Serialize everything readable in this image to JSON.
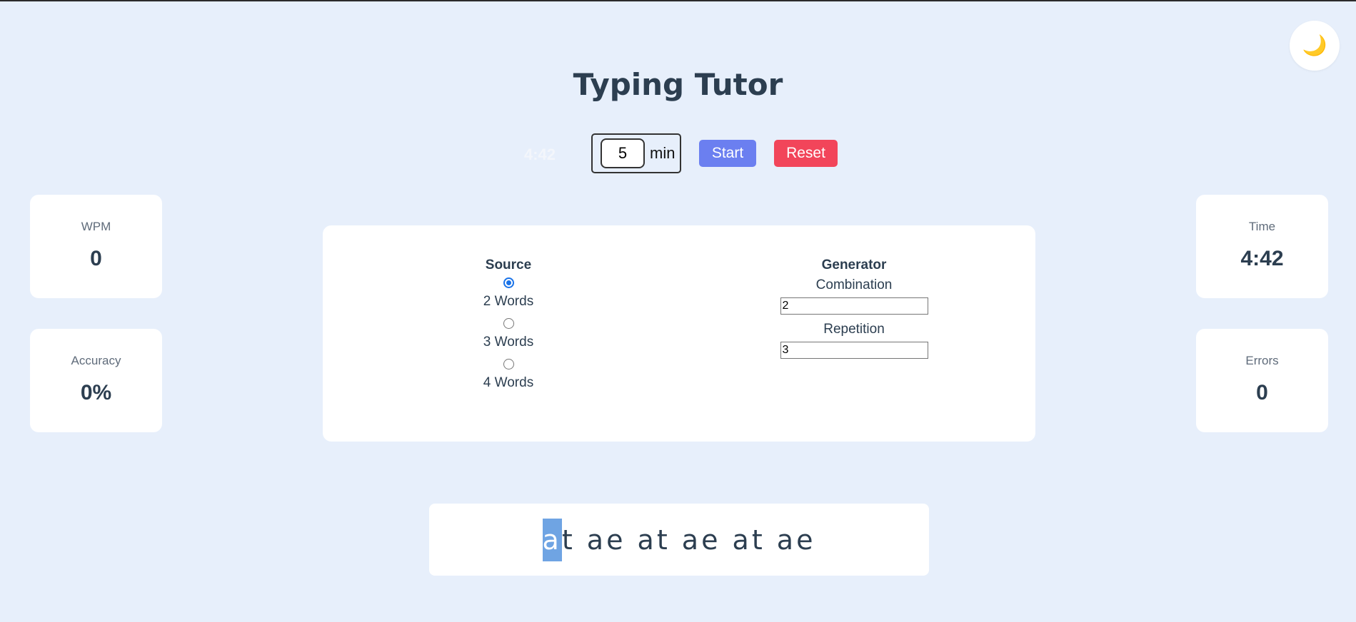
{
  "app": {
    "title": "Typing Tutor",
    "theme_icon": "🌙"
  },
  "controls": {
    "faded_time": "4:42",
    "duration_value": "5",
    "duration_unit": "min",
    "start_label": "Start",
    "reset_label": "Reset"
  },
  "stats": {
    "wpm": {
      "label": "WPM",
      "value": "0"
    },
    "accuracy": {
      "label": "Accuracy",
      "value": "0%"
    },
    "time": {
      "label": "Time",
      "value": "4:42"
    },
    "errors": {
      "label": "Errors",
      "value": "0"
    }
  },
  "settings": {
    "source_heading": "Source",
    "source_options": [
      {
        "label": "2 Words",
        "checked": true
      },
      {
        "label": "3 Words",
        "checked": false
      },
      {
        "label": "4 Words",
        "checked": false
      }
    ],
    "generator_heading": "Generator",
    "combination_label": "Combination",
    "combination_value": "2",
    "repetition_label": "Repetition",
    "repetition_value": "3"
  },
  "practice": {
    "current_char": "a",
    "remaining_text": "t ae at ae at ae"
  },
  "colors": {
    "background": "#e7effb",
    "start": "#6b7ff0",
    "reset": "#f2455a",
    "cursor_highlight": "#6fa4e3"
  }
}
